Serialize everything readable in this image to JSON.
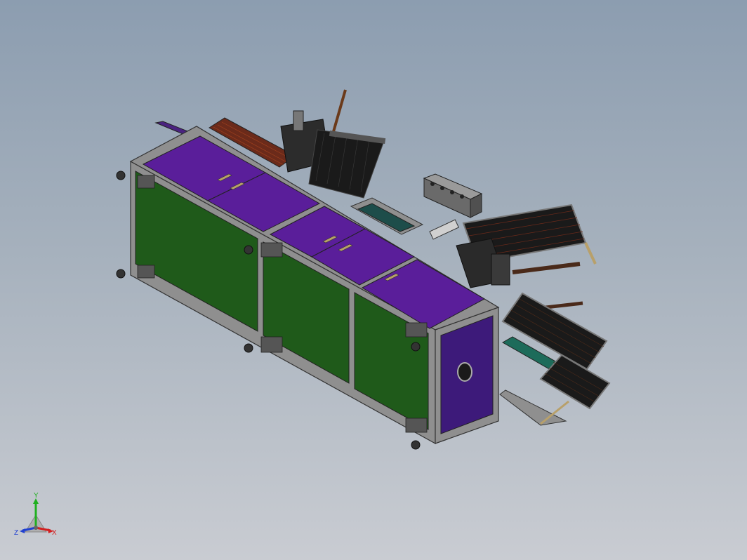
{
  "window": {
    "title": ""
  },
  "viewport": {
    "background_top": "#8c9db0",
    "background_bottom": "#c9ccd2"
  },
  "model": {
    "panel_top_color": "#5a1e9a",
    "panel_side_color": "#1f5a1a",
    "frame_color": "#8a8a8a",
    "end_panel_color": "#3d1a7a"
  },
  "triad": {
    "x_label": "X",
    "y_label": "Y",
    "z_label": "Z",
    "x_color": "#d22020",
    "y_color": "#20b020",
    "z_color": "#2040d0"
  }
}
